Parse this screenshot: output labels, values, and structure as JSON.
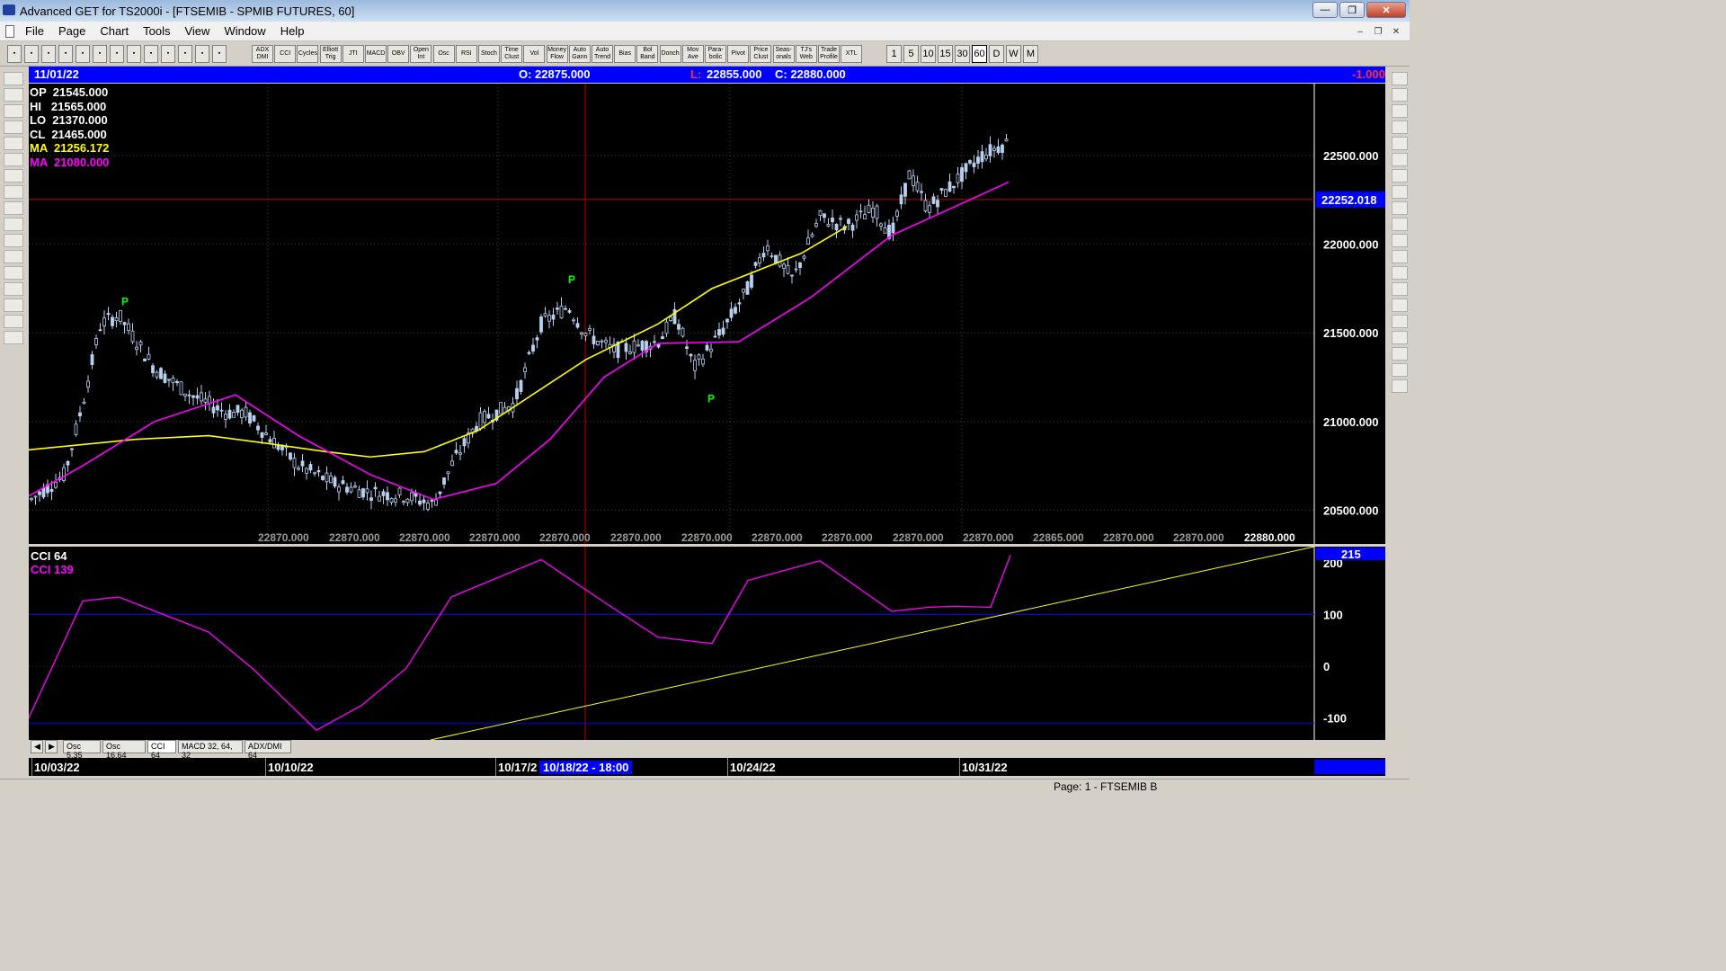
{
  "window": {
    "title": "Advanced GET for TS2000i - [FTSEMIB - SPMIB FUTURES, 60]",
    "minimize": "—",
    "maximize": "❐",
    "close": "✕"
  },
  "menu": {
    "items": [
      "File",
      "Page",
      "Chart",
      "Tools",
      "View",
      "Window",
      "Help"
    ]
  },
  "toolbar": {
    "studies": [
      "ADX DMI",
      "CCI",
      "Cycles",
      "Elliott Trig",
      "JTI",
      "MACD",
      "OBV",
      "Open Int",
      "Osc",
      "RSI",
      "Stoch",
      "Time Clust",
      "Vol",
      "Money Flow",
      "Auto Gann",
      "Auto Trend",
      "Bias",
      "Bol Band",
      "Donch",
      "Mov Ave",
      "Para-bolic",
      "Pivot",
      "Price Clust",
      "Seas-onals",
      "TJ's Web",
      "Trade Profile",
      "XTL"
    ],
    "intervals": [
      "1",
      "5",
      "10",
      "15",
      "30",
      "60",
      "D",
      "W",
      "M"
    ],
    "selected_interval": "60"
  },
  "infobar": {
    "date": "11/01/22",
    "open": "O: 22875.000",
    "low": "L:",
    "low_val": "22855.000",
    "close": "C:  22880.000",
    "change": "-1.000"
  },
  "legend": [
    {
      "label": "OP  21545.000",
      "color": "#ffffff"
    },
    {
      "label": "HI   21565.000",
      "color": "#ffffff"
    },
    {
      "label": "LO  21370.000",
      "color": "#ffffff"
    },
    {
      "label": "CL  21465.000",
      "color": "#ffffff"
    },
    {
      "label": "MA  21256.172",
      "color": "#ffff00"
    },
    {
      "label": "MA  21080.000",
      "color": "#ff00ff"
    }
  ],
  "price_axis": {
    "ticks": [
      "22500.000",
      "22000.000",
      "21500.000",
      "21000.000",
      "20500.000"
    ],
    "cursor_price": "22252.018"
  },
  "bottom_prices": [
    "22870.000",
    "22870.000",
    "22870.000",
    "22870.000",
    "22870.000",
    "22870.000",
    "22870.000",
    "22870.000",
    "22870.000",
    "22870.000",
    "22870.000",
    "22865.000",
    "22870.000",
    "22870.000"
  ],
  "last_price": "22880.000",
  "pivot_label": "P",
  "cci": {
    "title": "CCI 64",
    "value_label": "CCI  139",
    "ticks": [
      "200",
      "100",
      "0",
      "-100"
    ],
    "current": "215"
  },
  "tabs": [
    "Osc 5,35",
    "Osc 16,64",
    "CCI 64",
    "MACD 32, 64, 32",
    "ADX/DMI 64"
  ],
  "active_tab": "CCI 64",
  "dates": [
    "10/03/22",
    "10/10/22",
    "10/17/2",
    "10/24/22",
    "10/31/22"
  ],
  "cursor_date": "10/18/22 - 18:00",
  "status": "Page: 1 - FTSEMIB B",
  "chart_data": {
    "type": "line",
    "series": [
      {
        "name": "MA",
        "color": "#ffff00",
        "values": [
          20840,
          20870,
          20900,
          20920,
          20880,
          20830,
          20800,
          20830,
          20950,
          21150,
          21350,
          21550,
          21750,
          21950,
          22100
        ]
      },
      {
        "name": "MA",
        "color": "#ff00ff",
        "values": [
          20580,
          20750,
          21000,
          21150,
          20920,
          20700,
          20560,
          20650,
          20900,
          21250,
          21440,
          21450,
          21700,
          22050,
          22350
        ]
      }
    ],
    "pivots": [
      21625,
      21750,
      21180
    ],
    "cci": [
      -100,
      140,
      120,
      80,
      -20,
      -110,
      -90,
      10,
      120,
      220,
      110,
      70,
      30,
      180,
      190,
      120,
      100,
      130,
      100,
      215
    ]
  }
}
